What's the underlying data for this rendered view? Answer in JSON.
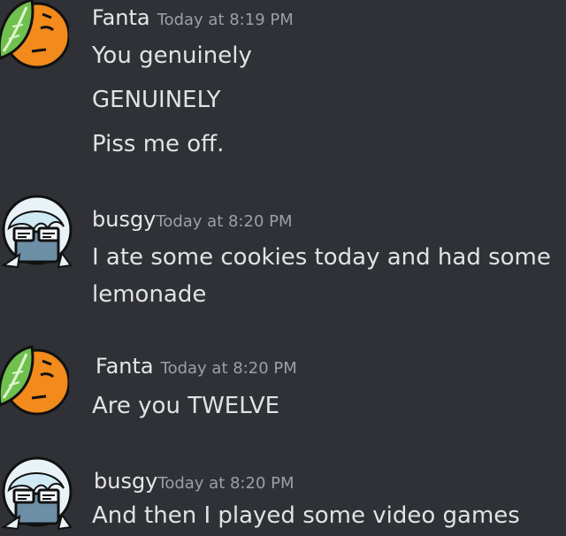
{
  "messages": [
    {
      "author": "Fanta",
      "timestamp": "Today at 8:19 PM",
      "avatar_icon": "orange-leaf-avatar-icon",
      "lines": [
        "You genuinely",
        "GENUINELY",
        "Piss me off."
      ]
    },
    {
      "author": "busgy",
      "timestamp": "Today at 8:20 PM",
      "avatar_icon": "white-haired-goggles-avatar-icon",
      "lines": [
        "I ate some cookies today and had some",
        "lemonade"
      ]
    },
    {
      "author": "Fanta",
      "timestamp": "Today at 8:20 PM",
      "avatar_icon": "orange-leaf-avatar-icon",
      "lines": [
        "Are you TWELVE"
      ]
    },
    {
      "author": "busgy",
      "timestamp": "Today at 8:20 PM",
      "avatar_icon": "white-haired-goggles-avatar-icon",
      "lines": [
        "And then I played some video games"
      ]
    }
  ],
  "colors": {
    "background": "#2f3136",
    "author": "#e6e7e9",
    "timestamp": "#9ba0a7",
    "text": "#e1e2e4",
    "orange": "#f28a1c",
    "leaf": "#6fc04e",
    "hair": "#e9f3f7",
    "skin": "#6d8fa6"
  }
}
